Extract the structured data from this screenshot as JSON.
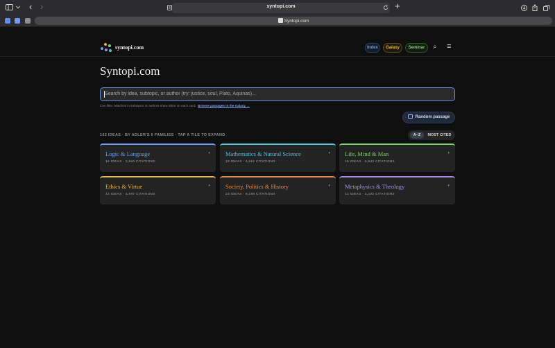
{
  "browser": {
    "url": "syntopi.com",
    "tab_title": "Syntopi.com",
    "icons": {
      "sidebar": "sidebar-icon",
      "chevron": "chevron-down-icon",
      "back": "back-icon",
      "forward": "forward-icon",
      "reader": "reader-icon",
      "reload": "reload-icon",
      "new_tab": "plus-icon",
      "download": "download-icon",
      "share": "share-icon",
      "tabs": "tabs-overview-icon"
    },
    "back_glyph": "‹",
    "forward_glyph": "›",
    "new_tab_glyph": "+"
  },
  "header": {
    "brand": "syntopi.com",
    "nav": [
      {
        "label": "Index",
        "color": "#6f9cf0"
      },
      {
        "label": "Galaxy",
        "color": "#e6b64a"
      },
      {
        "label": "Seminar",
        "color": "#7fd26a"
      }
    ],
    "search_glyph": "⌕",
    "menu_glyph": "≡"
  },
  "title": "Syntopi.com",
  "search": {
    "placeholder": "Search by idea, subtopic, or author (try: justice, soul, Plato, Aquinas)..."
  },
  "hint": {
    "text": "Live filter. Matches in subtopics or authors show inline on each card.",
    "link": "Browse passages in the Galaxy →"
  },
  "random_passage_label": "Random passage",
  "meta_line": "102 IDEAS · BY ADLER'S 6 FAMILIES · TAP A TILE TO EXPAND",
  "sort": {
    "options": [
      "A–Z",
      "MOST CITED"
    ],
    "active": "A–Z"
  },
  "families": [
    {
      "name": "Logic & Language",
      "stats": "16 IDEAS · 3,960 CITATIONS",
      "color": "#6f9cf0"
    },
    {
      "name": "Mathematics & Natural Science",
      "stats": "18 IDEAS · 4,661 CITATIONS",
      "color": "#4fc3d9"
    },
    {
      "name": "Life, Mind & Man",
      "stats": "18 IDEAS · 6,543 CITATIONS",
      "color": "#7fd26a"
    },
    {
      "name": "Ethics & Virtue",
      "stats": "12 IDEAS · 4,697 CITATIONS",
      "color": "#e6b64a"
    },
    {
      "name": "Society, Politics & History",
      "stats": "23 IDEAS · 9,199 CITATIONS",
      "color": "#e88b4a"
    },
    {
      "name": "Metaphysics & Theology",
      "stats": "13 IDEAS · 4,102 CITATIONS",
      "color": "#a58cf0"
    }
  ],
  "tile_caret": "▾"
}
